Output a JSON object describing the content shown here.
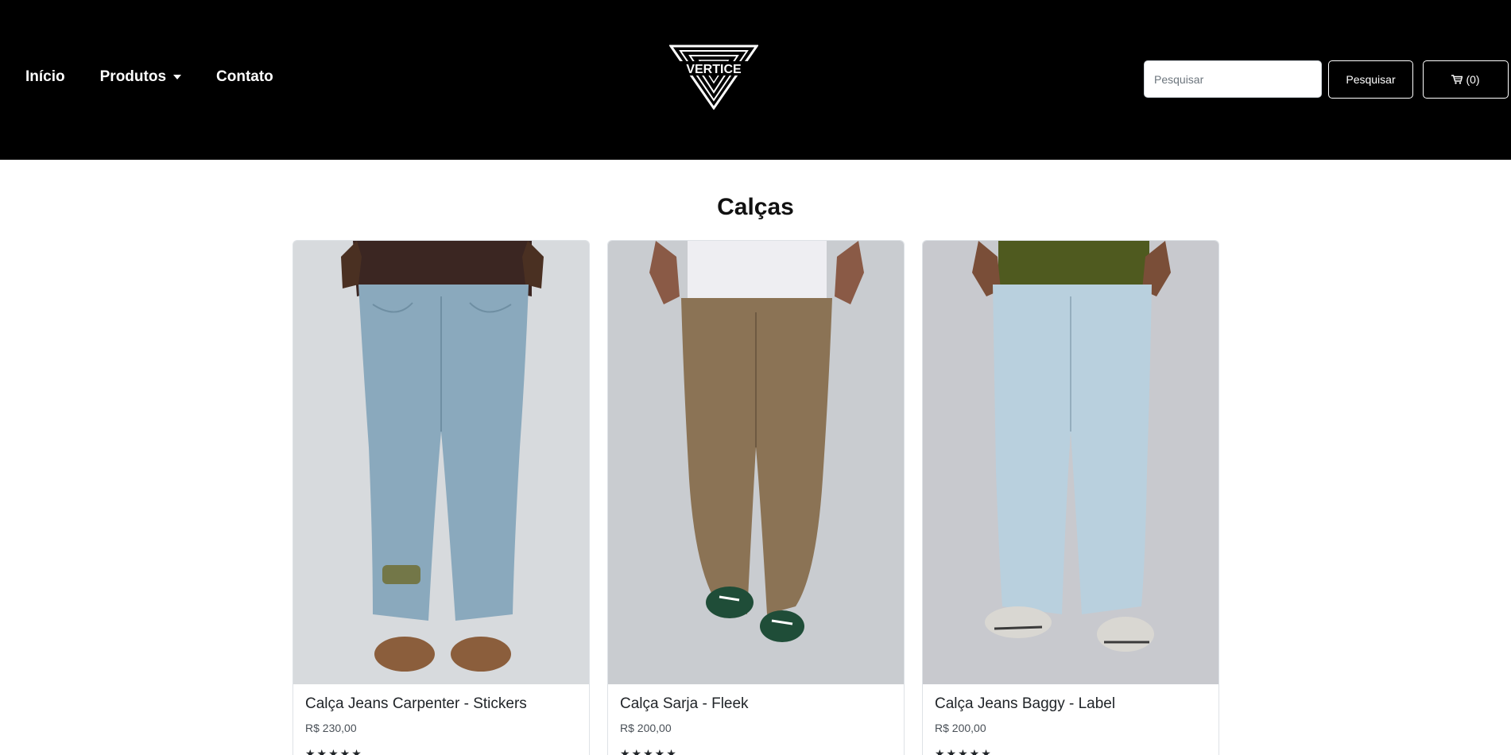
{
  "nav": {
    "links": [
      {
        "label": "Início"
      },
      {
        "label": "Produtos"
      },
      {
        "label": "Contato"
      }
    ],
    "logo_text": "VERTICE"
  },
  "search": {
    "placeholder": "Pesquisar",
    "button_label": "Pesquisar"
  },
  "cart": {
    "label": "(0)"
  },
  "section": {
    "title": "Calças"
  },
  "products": [
    {
      "name": "Calça Jeans Carpenter - Stickers",
      "price": "R$ 230,00",
      "rating": 5,
      "stars": "★★★★★"
    },
    {
      "name": "Calça Sarja - Fleek",
      "price": "R$ 200,00",
      "rating": 5,
      "stars": "★★★★★"
    },
    {
      "name": "Calça Jeans Baggy - Label",
      "price": "R$ 200,00",
      "rating": 5,
      "stars": "★★★★★"
    }
  ],
  "colors": {
    "navbar_bg": "#000000",
    "page_bg": "#ffffff",
    "text": "#212529"
  }
}
